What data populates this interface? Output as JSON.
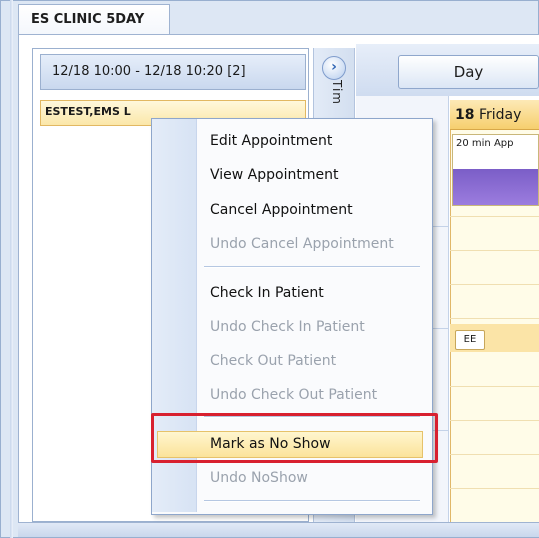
{
  "tab": {
    "label": "ES CLINIC 5DAY"
  },
  "appointments_list": {
    "header": "12/18 10:00 - 12/18 10:20  [2]",
    "rows": [
      "ESTEST,EMS L"
    ]
  },
  "splitter": {
    "time_label": "Tim"
  },
  "calendar": {
    "view_button": "Day",
    "day_number": "18",
    "day_name": "Friday",
    "appointments": [
      {
        "label": "20 min App"
      },
      {
        "label": "EE"
      }
    ],
    "colors": {
      "header": "#f6cf6e",
      "appointment_bar": "#8a6ad6",
      "day_column": "#fffce8"
    }
  },
  "context_menu": {
    "items": [
      {
        "label": "Edit Appointment",
        "enabled": true
      },
      {
        "label": "View Appointment",
        "enabled": true
      },
      {
        "label": "Cancel Appointment",
        "enabled": true
      },
      {
        "label": "Undo Cancel Appointment",
        "enabled": false
      },
      {
        "label": "Check In Patient",
        "enabled": true
      },
      {
        "label": "Undo Check In Patient",
        "enabled": false
      },
      {
        "label": "Check Out Patient",
        "enabled": false
      },
      {
        "label": "Undo Check Out Patient",
        "enabled": false
      },
      {
        "label": "Mark as No Show",
        "enabled": true,
        "highlighted": true
      },
      {
        "label": "Undo NoShow",
        "enabled": false
      }
    ],
    "highlight_color": "#fbe39a",
    "annotation_color": "#d8202f"
  },
  "icons": {
    "expand": "chevron-right-icon"
  }
}
